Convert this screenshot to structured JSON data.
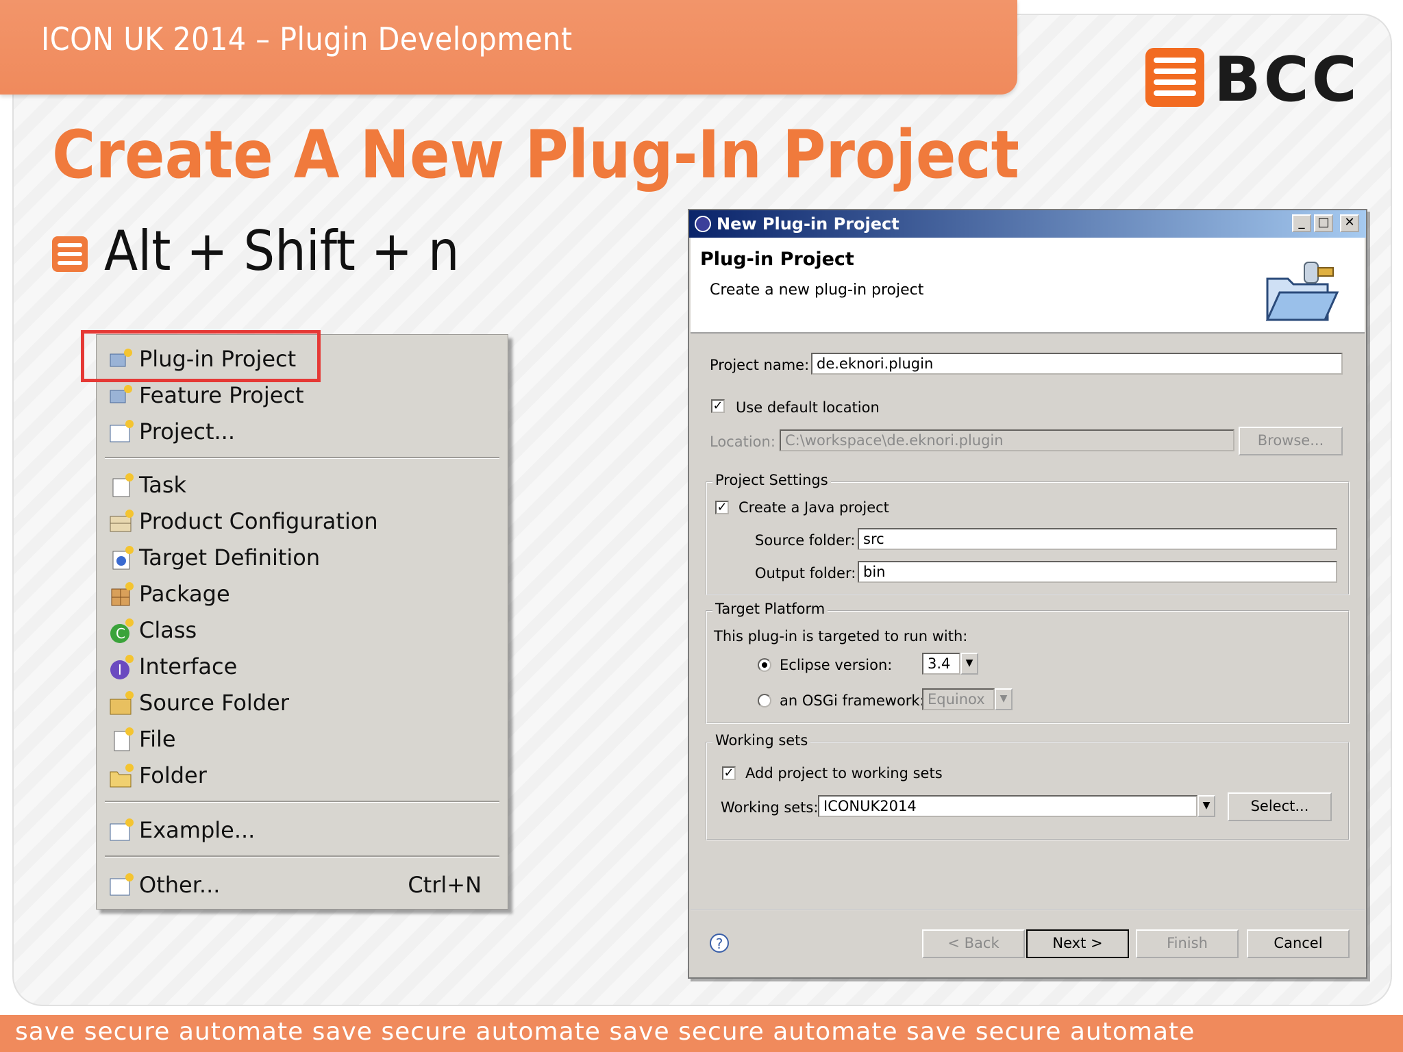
{
  "header": {
    "title": "ICON UK  2014 – Plugin Development"
  },
  "logo": {
    "text": "BCC"
  },
  "slide": {
    "title": "Create A New Plug-In Project",
    "bullet": "Alt + Shift + n"
  },
  "menu": {
    "items": [
      {
        "label": "Plug-in Project",
        "icon": "plugin-project-icon"
      },
      {
        "label": "Feature Project",
        "icon": "feature-project-icon"
      },
      {
        "label": "Project...",
        "icon": "project-icon"
      },
      {
        "label": "Task",
        "icon": "task-icon"
      },
      {
        "label": "Product Configuration",
        "icon": "product-configuration-icon"
      },
      {
        "label": "Target Definition",
        "icon": "target-definition-icon"
      },
      {
        "label": "Package",
        "icon": "package-icon"
      },
      {
        "label": "Class",
        "icon": "class-icon"
      },
      {
        "label": "Interface",
        "icon": "interface-icon"
      },
      {
        "label": "Source Folder",
        "icon": "source-folder-icon"
      },
      {
        "label": "File",
        "icon": "file-icon"
      },
      {
        "label": "Folder",
        "icon": "folder-icon"
      },
      {
        "label": "Example...",
        "icon": "example-icon"
      },
      {
        "label": "Other...",
        "icon": "other-icon",
        "shortcut": "Ctrl+N"
      }
    ]
  },
  "dialog": {
    "title": "New Plug-in Project",
    "heading": "Plug-in Project",
    "subheading": "Create a new plug-in project",
    "project_name_label": "Project name:",
    "project_name_value": "de.eknori.plugin",
    "use_default_location": "Use default location",
    "location_label": "Location:",
    "location_value": "C:\\workspace\\de.eknori.plugin",
    "browse": "Browse...",
    "project_settings": {
      "title": "Project Settings",
      "create_java": "Create a Java project",
      "source_label": "Source folder:",
      "source_value": "src",
      "output_label": "Output folder:",
      "output_value": "bin"
    },
    "target_platform": {
      "title": "Target Platform",
      "desc": "This plug-in is targeted to run with:",
      "eclipse_label": "Eclipse version:",
      "eclipse_value": "3.4",
      "osgi_label": "an OSGi framework:",
      "osgi_value": "Equinox"
    },
    "working_sets": {
      "title": "Working sets",
      "add": "Add project to working sets",
      "label": "Working sets:",
      "value": "ICONUK2014",
      "select": "Select..."
    },
    "buttons": {
      "back": "< Back",
      "next": "Next >",
      "finish": "Finish",
      "cancel": "Cancel"
    }
  },
  "footer": {
    "text": "save secure automate save secure automate save secure automate save secure automate"
  },
  "colors": {
    "accent": "#f07a3c",
    "highlight": "#e53935"
  }
}
